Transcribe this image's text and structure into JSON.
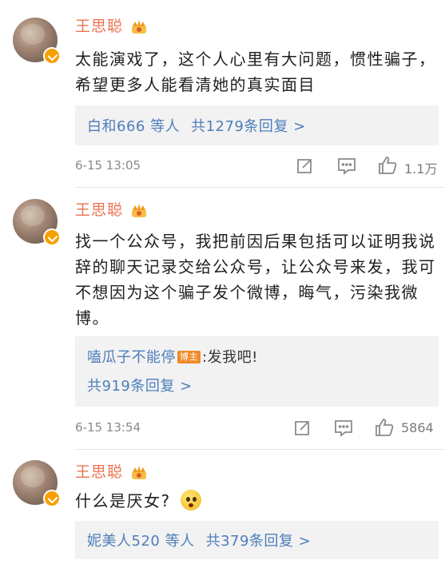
{
  "comments": [
    {
      "username": "王思聪",
      "content": "太能演戏了，这个人心里有大问题，惯性骗子，希望更多人能看清她的真实面目",
      "reply_users": "白和666 等人",
      "reply_count": "共1279条回复 >",
      "timestamp": "6-15 13:05",
      "likes": "1.1万"
    },
    {
      "username": "王思聪",
      "content": "找一个公众号，我把前因后果包括可以证明我说辞的聊天记录交给公众号，让公众号来发，我可不想因为这个骗子发个微博，晦气，污染我微博。",
      "sub_reply_user": "嗑瓜子不能停",
      "sub_reply_tag": "博主",
      "sub_reply_text": ":发我吧!",
      "reply_count": "共919条回复 >",
      "timestamp": "6-15 13:54",
      "likes": "5864"
    },
    {
      "username": "王思聪",
      "content": "什么是厌女?",
      "reply_users": "妮美人520 等人",
      "reply_count": "共379条回复 >"
    }
  ],
  "colors": {
    "username": "#eb7350",
    "link": "#4d7ebb",
    "reply_bg": "#f2f2f2",
    "meta": "#8a8a8a",
    "verified_badge": "#f6a000"
  },
  "icons": [
    "verified-badge-icon",
    "crown-icon",
    "share-icon",
    "comment-icon",
    "like-icon",
    "surprised-emoji-icon"
  ]
}
